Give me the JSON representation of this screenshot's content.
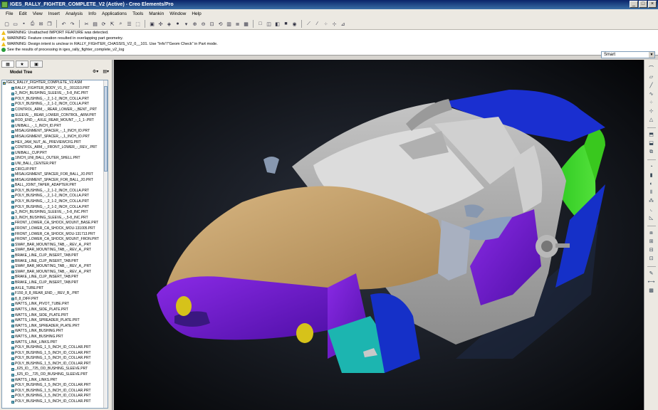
{
  "window": {
    "title": "IGES_RALLY_FIGHTER_COMPLETE_V2 (Active) - Creo Elements/Pro",
    "controls": [
      "_",
      "□",
      "×"
    ]
  },
  "menu": [
    "File",
    "Edit",
    "View",
    "Insert",
    "Analysis",
    "Info",
    "Applications",
    "Tools",
    "Mankin",
    "Window",
    "Help"
  ],
  "messages": [
    {
      "type": "warning",
      "text": "WARNING: Unattached IMPORT FEATURE was detected."
    },
    {
      "type": "warning",
      "text": "WARNING: Feature creation resulted in overlapping part geometry."
    },
    {
      "type": "warning",
      "text": "WARNING: Design intent is unclear in RALLY_FIGHTER_CHASSIS_V2_0__101.  Use \"Info\"/\"Geom Check\" in Part mode."
    },
    {
      "type": "ok",
      "text": "See the results of processing in iges_rally_fighter_complete_v2_log"
    }
  ],
  "filter": {
    "value": "Smart"
  },
  "nav": {
    "tabs": [
      "▦",
      "★",
      "▣"
    ],
    "model_tree_label": "Model Tree"
  },
  "tree": {
    "root": "IGES_RALLY_FIGHTER_COMPLETE_V2.ASM",
    "items": [
      "RALLY_FIGHTER_BODY_V1_0__001310.PRT",
      "3_INCH_BUSHING_SLEEVE_-_5-8_INC.PRT",
      "POLY_BUSHING_-_2_1-2_INCH_COLLA.PRT",
      "POLY_BUSHING_-_2_1-2_INCH_COLLA.PRT",
      "CONTROL_ARM_-_REAR_LOWER_-_BENT_.PRT",
      "SLEEVE_-_REAR_LOWER_CONTROL_ARM.PRT",
      "ROD_END_-_AXLE_REAR_MOUNT_-_1_1-.PRT",
      "UNIBALL_-_1_INCH_ID.PRT",
      "MISALIGNMENT_SPACER_-_1_INCH_ID.PRT",
      "MISALIGNMENT_SPACER_-_1_INCH_ID.PRT",
      "HEX_JAM_NUT_AL_PREVIEWCFG.PRT",
      "CONTROL_ARM_-_FRONT_LOWER_-_REV_.PRT",
      "UNIBALL_CUP.PRT",
      "1INCH_UNI_BALL_OUTER_SHELL.PRT",
      "UNI_BALL_CENTER.PRT",
      "CIRCLIP.PRT",
      "MISALIGNMENT_SPACER_FOR_BALL_JO.PRT",
      "MISALIGNMENT_SPACER_FOR_BALL_JO.PRT",
      "BALL_JOINT_TAPER_ADAPTER.PRT",
      "POLY_BUSHING_-_2_1-2_INCH_COLLA.PRT",
      "POLY_BUSHING_-_2_1-2_INCH_COLLA.PRT",
      "POLY_BUSHING_-_2_1-2_INCH_COLLA.PRT",
      "POLY_BUSHING_-_2_1-2_INCH_COLLA.PRT",
      "3_INCH_BUSHING_SLEEVE_-_5-8_INC.PRT",
      "3_INCH_BUSHING_SLEEVE_-_5-8_INC.PRT",
      "FRONT_LOWER_CA_SHOCK_MOUNT_BASE.PRT",
      "FRONT_LOWER_CA_SHOCK_MOU-131005.PRT",
      "FRONT_LOWER_CA_SHOCK_MOU-131713.PRT",
      "FRONT_LOWER_CA_SHOCK_MOUNT_FRON.PRT",
      "SWAY_BAR_MOUNTING_TAB_-_REV_A_.PRT",
      "SWAY_BAR_MOUNTING_TAB_-_REV_A_.PRT",
      "BRAKE_LINE_CLIP_INSERT_TAB.PRT",
      "BRAKE_LINE_CLIP_INSERT_TAB.PRT",
      "SWAY_BAR_MOUNTING_TAB_-_REV_A_.PRT",
      "SWAY_BAR_MOUNTING_TAB_-_REV_A_.PRT",
      "BRAKE_LINE_CLIP_INSERT_TAB.PRT",
      "BRAKE_LINE_CLIP_INSERT_TAB.PRT",
      "AXLE_TUBE.PRT",
      "F150_8_8_REAR_END_-_REV_B_.PRT",
      "8_8_DIFF.PRT",
      "WATTS_LINK_PIVOT_TUBE.PRT",
      "WATTS_LINK_SIDE_PLATE.PRT",
      "WATTS_LINK_SIDE_PLATE.PRT",
      "WATTS_LINK_SPREADER_PLATE.PRT",
      "WATTS_LINK_SPREADER_PLATE.PRT",
      "WATTS_LINK_BUSHING.PRT",
      "WATTS_LINK_BUSHING.PRT",
      "WATTS_LINK_LINKS.PRT",
      "POLY_BUSHING_1_5_INCH_ID_COLLAR.PRT",
      "POLY_BUSHING_1_5_INCH_ID_COLLAR.PRT",
      "POLY_BUSHING_1_5_INCH_ID_COLLAR.PRT",
      "POLY_BUSHING_1_5_INCH_ID_COLLAR.PRT",
      "_625_ID__725_OD_BUSHING_SLEEVE.PRT",
      "_625_ID__725_OD_BUSHING_SLEEVE.PRT",
      "WATTS_LINK_LINKS.PRT",
      "POLY_BUSHING_1_5_INCH_ID_COLLAR.PRT",
      "POLY_BUSHING_1_5_INCH_ID_COLLAR.PRT",
      "POLY_BUSHING_1_5_INCH_ID_COLLAR.PRT",
      "POLY_BUSHING_1_5_INCH_ID_COLLAR.PRT"
    ]
  },
  "colors": {
    "title_bar": "#0a246a",
    "body_tan": "#c8a36e",
    "panel_gray": "#a9a9a9",
    "purple": "#6a14c8",
    "green": "#39c81e",
    "blue": "#1530c8",
    "cyan": "#1cb5b0",
    "yellow": "#d6c21a",
    "glass": "#d8d8d8"
  }
}
